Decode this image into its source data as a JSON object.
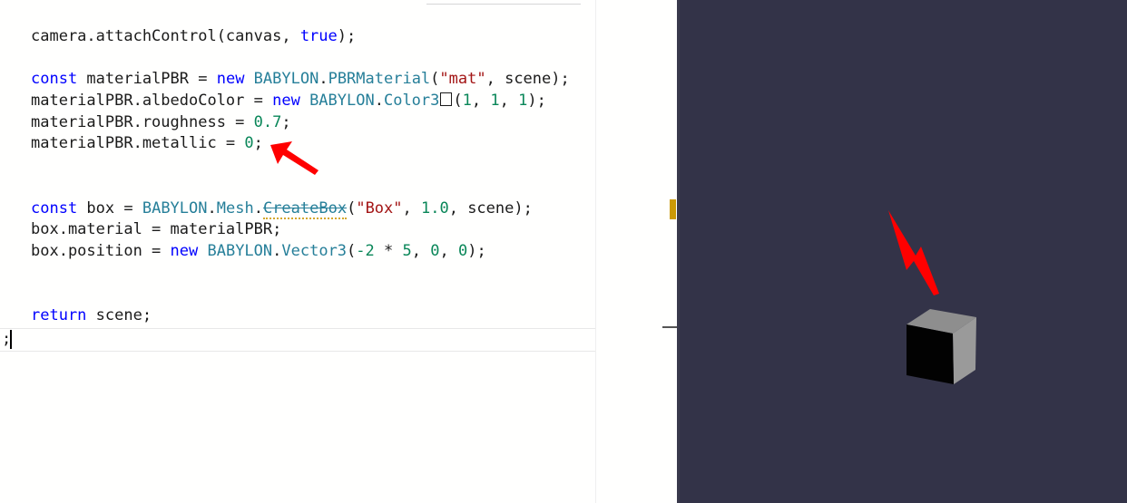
{
  "editor": {
    "lines": {
      "l1_a": "camera.attachControl(canvas, ",
      "l1_b": "true",
      "l1_c": ");",
      "l2_const": "const",
      "l2_name": " materialPBR = ",
      "l2_new": "new",
      "l2_babylon": " BABYLON",
      "l2_dot": ".",
      "l2_type": "PBRMaterial",
      "l2_open": "(",
      "l2_str": "\"mat\"",
      "l2_rest": ", scene);",
      "l3_name": "materialPBR.albedoColor = ",
      "l3_new": "new",
      "l3_babylon": " BABYLON",
      "l3_dot": ".",
      "l3_type": "Color3",
      "l3_open": "(",
      "l3_n1": "1",
      "l3_sep1": ", ",
      "l3_n2": "1",
      "l3_sep2": ", ",
      "l3_n3": "1",
      "l3_close": ");",
      "l4_name": "materialPBR.roughness = ",
      "l4_val": "0.7",
      "l4_end": ";",
      "l5_name": "materialPBR.metallic = ",
      "l5_val": "0",
      "l5_end": ";",
      "l6_const": "const",
      "l6_name": " box = ",
      "l6_babylon": "BABYLON",
      "l6_dot1": ".",
      "l6_mesh": "Mesh",
      "l6_dot2": ".",
      "l6_fn": "CreateBox",
      "l6_open": "(",
      "l6_str": "\"Box\"",
      "l6_sep": ", ",
      "l6_num": "1.0",
      "l6_rest": ", scene);",
      "l7": "box.material = materialPBR;",
      "l8_name": "box.position = ",
      "l8_new": "new",
      "l8_babylon": " BABYLON",
      "l8_dot": ".",
      "l8_type": "Vector3",
      "l8_open": "(",
      "l8_n1": "-2",
      "l8_op": " * ",
      "l8_n2": "5",
      "l8_sep1": ", ",
      "l8_n3": "0",
      "l8_sep2": ", ",
      "l8_n4": "0",
      "l8_close": ");",
      "l9_kw": "return",
      "l9_rest": " scene;",
      "l10": ";"
    }
  },
  "colors": {
    "keyword": "#0000ff",
    "type": "#267f99",
    "string": "#a31515",
    "number": "#098658",
    "viewport_bg": "#333348",
    "arrow": "#ff0000"
  },
  "annotations": {
    "arrow_icon": "red-arrow-icon"
  },
  "scene": {
    "object": "box"
  }
}
